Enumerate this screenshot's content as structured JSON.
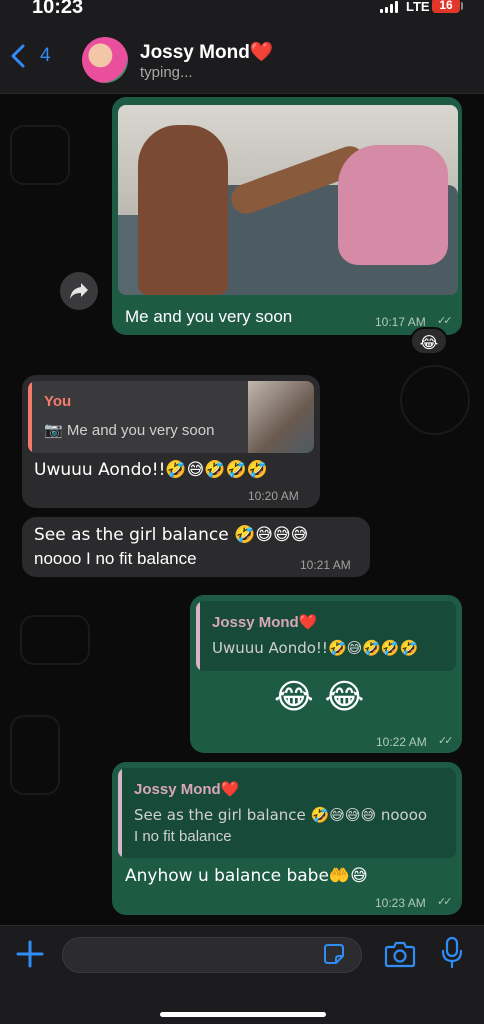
{
  "status_bar": {
    "time": "10:23",
    "network": "LTE",
    "battery": "16"
  },
  "header": {
    "back_count": "4",
    "contact_name": "Jossy Mond",
    "contact_heart": "❤️",
    "status": "typing..."
  },
  "messages": [
    {
      "direction": "out",
      "type": "photo",
      "caption": "Me and you very soon",
      "time": "10:17 AM",
      "reaction": "😂"
    },
    {
      "direction": "in",
      "reply_to": {
        "author": "You",
        "text": "Me and you very soon",
        "has_photo": true
      },
      "text": "Uwuuu Aondo!!🤣😅🤣🤣🤣",
      "time": "10:20 AM"
    },
    {
      "direction": "in",
      "text_line1": "See as the girl balance 🤣😅😅😅",
      "text_line2": "noooo I no fit balance",
      "time": "10:21 AM"
    },
    {
      "direction": "out",
      "reply_to": {
        "author": "Jossy Mond❤️",
        "text": "Uwuuu Aondo!!🤣😅🤣🤣🤣"
      },
      "text": "😂 😂",
      "time": "10:22 AM"
    },
    {
      "direction": "out",
      "reply_to": {
        "author": "Jossy Mond❤️",
        "text_line1": "See as the girl balance 🤣😅😅😅 noooo",
        "text_line2": "I no fit balance"
      },
      "text": "Anyhow u balance babe🤲😅",
      "time": "10:23 AM"
    }
  ],
  "input": {
    "placeholder": ""
  },
  "colors": {
    "outgoing_bubble": "#1d5b45",
    "incoming_bubble": "#2b2b2d",
    "accent": "#2f8df5"
  },
  "icons": [
    "back-chevron-icon",
    "forward-icon",
    "camera-icon",
    "plus-icon",
    "sticker-icon",
    "microphone-icon"
  ]
}
